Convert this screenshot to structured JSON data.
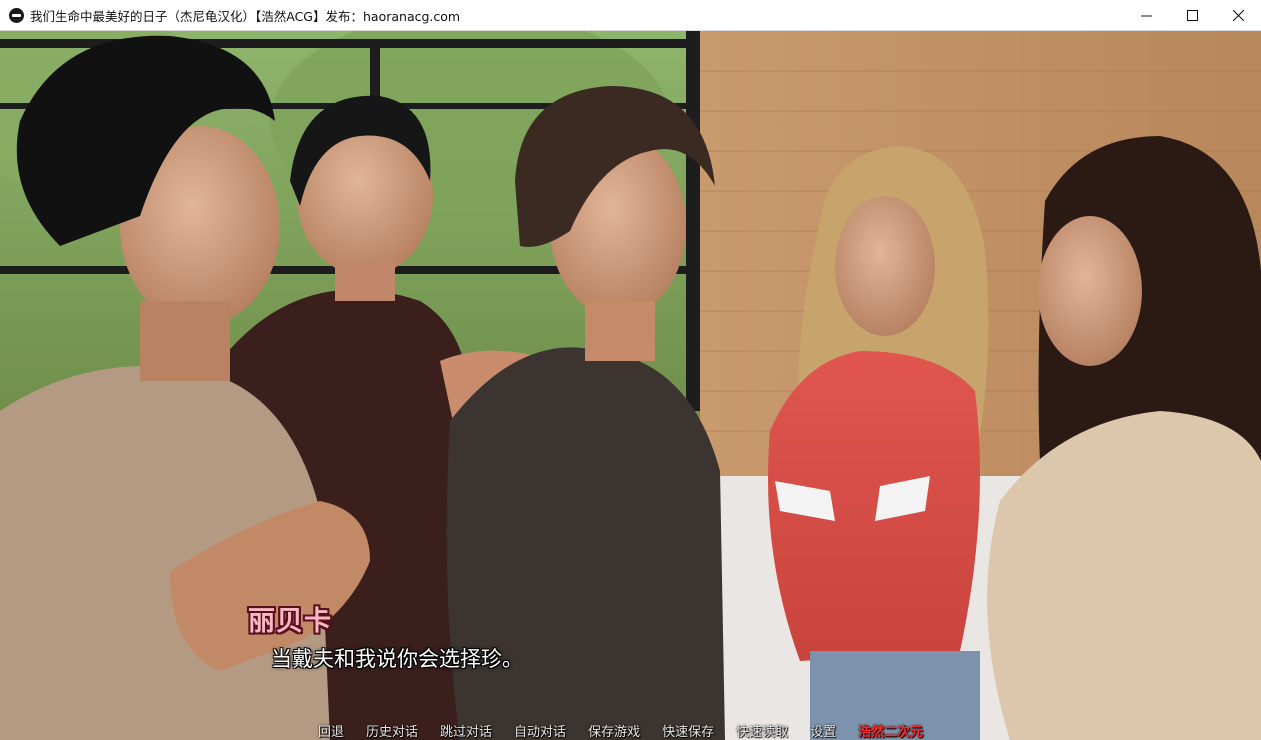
{
  "window": {
    "title": "我们生命中最美好的日子（杰尼龟汉化）【浩然ACG】发布：haoranacg.com",
    "controls": {
      "minimize_icon": "minimize-icon",
      "maximize_icon": "maximize-icon",
      "close_icon": "close-icon"
    }
  },
  "dialogue": {
    "speaker": "丽贝卡",
    "speaker_color": "#f6b8c3",
    "text": "当戴夫和我说你会选择珍。"
  },
  "quick_menu": {
    "items": [
      "回退",
      "历史对话",
      "跳过对话",
      "自动对话",
      "保存游戏",
      "快速保存",
      "快速读取",
      "设置"
    ],
    "extra": "浩然二次元",
    "extra_color": "#ff2a2a"
  }
}
